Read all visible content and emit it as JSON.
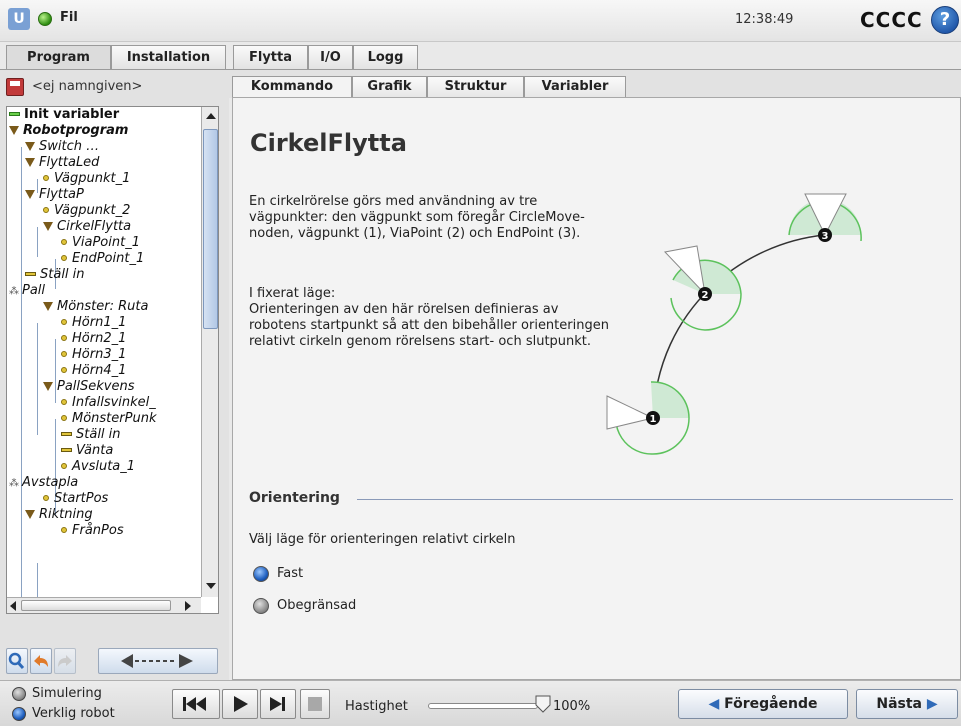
{
  "topbar": {
    "logo_text": "U",
    "file_menu": "Fil",
    "clock": "12:38:49",
    "robot_name": "CCCC",
    "help_symbol": "?"
  },
  "main_tabs": [
    "Program",
    "Installation",
    "Flytta",
    "I/O",
    "Logg"
  ],
  "active_main_tab": "Program",
  "left_panel": {
    "program_name": "<ej namngiven>",
    "tree": [
      {
        "label": "Init variabler",
        "icon": "init-bar-icon",
        "style": "bold"
      },
      {
        "label": "Robotprogram",
        "icon": "triangle-icon",
        "style": "bold-italic"
      },
      {
        "label": "Switch …",
        "icon": "triangle-icon",
        "style": "italic"
      },
      {
        "label": "FlyttaLed",
        "icon": "triangle-icon",
        "style": "italic"
      },
      {
        "label": "Vägpunkt_1",
        "icon": "waypoint-icon",
        "style": "italic"
      },
      {
        "label": "FlyttaP",
        "icon": "triangle-icon",
        "style": "italic"
      },
      {
        "label": "Vägpunkt_2",
        "icon": "waypoint-icon",
        "style": "italic"
      },
      {
        "label": "CirkelFlytta",
        "icon": "triangle-icon",
        "style": "italic",
        "selected": true
      },
      {
        "label": "ViaPoint_1",
        "icon": "waypoint-icon",
        "style": "italic"
      },
      {
        "label": "EndPoint_1",
        "icon": "waypoint-icon",
        "style": "italic"
      },
      {
        "label": "Ställ in",
        "icon": "set-bar-icon",
        "style": "italic"
      },
      {
        "label": "Pall",
        "icon": "pallet-icon",
        "style": "italic"
      },
      {
        "label": "Mönster: Ruta",
        "icon": "triangle-icon",
        "style": "italic"
      },
      {
        "label": "Hörn1_1",
        "icon": "waypoint-icon",
        "style": "italic"
      },
      {
        "label": "Hörn2_1",
        "icon": "waypoint-icon",
        "style": "italic"
      },
      {
        "label": "Hörn3_1",
        "icon": "waypoint-icon",
        "style": "italic"
      },
      {
        "label": "Hörn4_1",
        "icon": "waypoint-icon",
        "style": "italic"
      },
      {
        "label": "PallSekvens",
        "icon": "triangle-icon",
        "style": "italic"
      },
      {
        "label": "Infallsvinkel_",
        "icon": "waypoint-icon",
        "style": "italic"
      },
      {
        "label": "MönsterPunk",
        "icon": "waypoint-icon",
        "style": "italic"
      },
      {
        "label": "Ställ in",
        "icon": "set-bar-icon",
        "style": "italic"
      },
      {
        "label": "Vänta",
        "icon": "set-bar-icon",
        "style": "italic"
      },
      {
        "label": "Avsluta_1",
        "icon": "waypoint-icon",
        "style": "italic"
      },
      {
        "label": "Avstapla",
        "icon": "pallet-icon",
        "style": "italic"
      },
      {
        "label": "StartPos",
        "icon": "waypoint-icon",
        "style": "italic"
      },
      {
        "label": "Riktning",
        "icon": "triangle-icon",
        "style": "italic"
      },
      {
        "label": "FrånPos",
        "icon": "waypoint-icon",
        "style": "italic"
      }
    ]
  },
  "sub_tabs": [
    "Kommando",
    "Grafik",
    "Struktur",
    "Variabler"
  ],
  "active_sub_tab": "Kommando",
  "content": {
    "title": "CirkelFlytta",
    "desc_para1": "En cirkelrörelse görs med användning av tre vägpunkter: den vägpunkt som föregår CircleMove-noden, vägpunkt (1), ViaPoint (2) och EndPoint (3).",
    "desc_para2_head": "I fixerat läge:",
    "desc_para2": "Orienteringen av den här rörelsen definieras av robotens startpunkt så att den bibehåller orienteringen relativt cirkeln genom rörelsens start- och slutpunkt.",
    "diagram_points": [
      "1",
      "2",
      "3"
    ],
    "orientation_heading": "Orientering",
    "orientation_desc": "Välj läge för orienteringen relativt cirkeln",
    "options": [
      {
        "label": "Fast",
        "selected": true
      },
      {
        "label": "Obegränsad",
        "selected": false
      }
    ]
  },
  "footer": {
    "mode_simulation": "Simulering",
    "mode_real": "Verklig robot",
    "speed_label": "Hastighet",
    "speed_value": "100%",
    "speed_fraction": 1.0,
    "prev_label": "Föregående",
    "next_label": "Nästa"
  },
  "colors": {
    "selection": "#b8cbe6",
    "accent_blue": "#2f6ab8",
    "waypoint_green": "#5cc25c"
  }
}
